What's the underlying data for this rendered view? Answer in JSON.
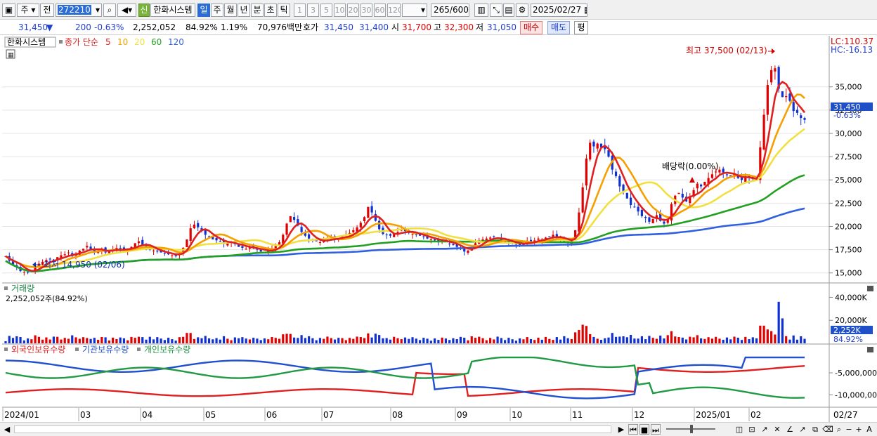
{
  "toolbar": {
    "market_select": "주",
    "prev_label": "전",
    "stock_code": "272210",
    "badge": "신",
    "stock_name": "한화시스템",
    "periods": [
      "일",
      "주",
      "월",
      "년",
      "분",
      "초",
      "틱"
    ],
    "active_period": "일",
    "intervals": [
      "1",
      "3",
      "5",
      "10",
      "20",
      "30",
      "60",
      "120"
    ],
    "count_value": "265",
    "count_max": "/600",
    "date": "2025/02/27"
  },
  "info": {
    "price": "31,450",
    "direction": "▼",
    "change": "200",
    "change_pct": "-0.63%",
    "volume": "2,252,052",
    "volume_ratio": "84.92%",
    "turnover": "1.19%",
    "amount": "70,976백만",
    "bid_label": "호가",
    "ask_price": "31,450",
    "bid_price": "31,400",
    "open_label": "시",
    "open": "31,700",
    "high_label": "고",
    "high": "32,300",
    "low_label": "저",
    "low": "31,050",
    "buy_label": "매수",
    "sell_label": "매도",
    "avg_label": "평"
  },
  "chart_data": [
    {
      "type": "candlestick",
      "title": "한화시스템",
      "legend_label": "종가 단순",
      "moving_averages": [
        {
          "name": "5",
          "color": "#e02020"
        },
        {
          "name": "10",
          "color": "#f5a000"
        },
        {
          "name": "20",
          "color": "#f2e040"
        },
        {
          "name": "60",
          "color": "#22a022"
        },
        {
          "name": "120",
          "color": "#3060e0"
        }
      ],
      "ylim": [
        14000,
        38600
      ],
      "yticks": [
        15000,
        17500,
        20000,
        22500,
        25000,
        27500,
        30000,
        32500,
        35000
      ],
      "ytick_labels": [
        "15,000",
        "17,500",
        "20,000",
        "22,500",
        "25,000",
        "27,500",
        "30,000",
        "32,500",
        "35,000"
      ],
      "current_price_label": "31,450",
      "current_change_label": "-0.63%",
      "lc_label": "LC:110.37",
      "hc_label": "HC:-16.13",
      "high_annotation": "최고 37,500 (02/13)",
      "low_annotation": "최저 14,950 (02/06)",
      "dividend_annotation": "배당락(0.00%)",
      "close_series": [
        16800,
        16300,
        15900,
        15600,
        15200,
        15100,
        15050,
        15200,
        15600,
        16000,
        16200,
        16400,
        16500,
        16300,
        16700,
        16900,
        17000,
        17200,
        16800,
        17100,
        17400,
        17600,
        17900,
        17500,
        17300,
        17400,
        17600,
        17200,
        17300,
        17500,
        17700,
        17600,
        17400,
        17500,
        17800,
        18200,
        18400,
        18000,
        17800,
        17500,
        17400,
        17300,
        17200,
        17100,
        17000,
        16900,
        16800,
        17100,
        17700,
        18600,
        19800,
        20200,
        19900,
        19500,
        19100,
        18900,
        18600,
        18500,
        18400,
        18100,
        18200,
        18300,
        18100,
        17800,
        17700,
        17600,
        17800,
        17700,
        17500,
        17300,
        17200,
        17400,
        17600,
        17900,
        18300,
        19100,
        20300,
        21100,
        20700,
        20100,
        19400,
        19000,
        18700,
        18500,
        18400,
        18300,
        18500,
        18700,
        18900,
        18700,
        18600,
        18900,
        19100,
        19300,
        19600,
        19900,
        20400,
        21000,
        22100,
        21500,
        20600,
        19700,
        19200,
        19100,
        19000,
        19200,
        19400,
        19700,
        19500,
        19300,
        19200,
        19100,
        19000,
        18900,
        18700,
        18600,
        18500,
        18400,
        18500,
        18300,
        18100,
        18000,
        17800,
        17600,
        17300,
        17400,
        17800,
        18200,
        18400,
        18600,
        18700,
        18800,
        18900,
        18700,
        18500,
        18400,
        18300,
        18200,
        18100,
        18000,
        18200,
        18400,
        18300,
        18500,
        18700,
        18600,
        18800,
        18900,
        19100,
        18800,
        18700,
        18400,
        18200,
        18500,
        19600,
        21500,
        24200,
        27300,
        29000,
        28600,
        28900,
        28500,
        28300,
        27500,
        26100,
        25400,
        24300,
        23700,
        23000,
        22300,
        22100,
        21600,
        21100,
        20900,
        20500,
        20800,
        21200,
        20600,
        20300,
        20800,
        22400,
        23300,
        23600,
        23100,
        22700,
        23200,
        23900,
        24600,
        24300,
        24800,
        25200,
        25600,
        25900,
        26100,
        25800,
        25500,
        25300,
        25600,
        25200,
        25000,
        25400,
        25200,
        25100,
        24900,
        28500,
        32000,
        35200,
        36800,
        37000,
        34800,
        33900,
        34000,
        33500,
        32400,
        32200,
        31650,
        31450
      ],
      "volume_scale": [
        0,
        47000
      ],
      "volume_ticks": [
        20000,
        40000
      ],
      "volume_tick_labels": [
        "20,000K",
        "40,000K"
      ],
      "volume_title": "거래량",
      "volume_value": "2,252,052주(84.92%)",
      "volume_current_label": "2,252K",
      "volume_current_pct": "84.92%",
      "holding_title_foreign": "외국인보유수량",
      "holding_title_inst": "기관보유수량",
      "holding_title_retail": "개인보유수량",
      "holding_ticks": [
        -5000000,
        -10000000
      ],
      "holding_tick_labels": [
        "-5,000,000",
        "-10,000,000"
      ],
      "x_labels": [
        "2024/01",
        "03",
        "04",
        "05",
        "06",
        "07",
        "08",
        "09",
        "10",
        "11",
        "12",
        "2025/01",
        "02"
      ],
      "x_end_label": "02/27"
    }
  ]
}
